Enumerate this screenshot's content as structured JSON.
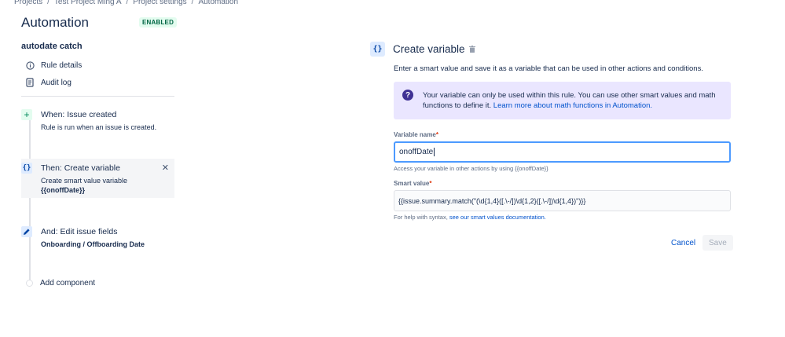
{
  "breadcrumb": [
    "Projects",
    "Test Project Ming A",
    "Project settings",
    "Automation"
  ],
  "page": {
    "title": "Automation",
    "status_badge": "ENABLED"
  },
  "rule": {
    "name": "autodate catch",
    "nav": [
      {
        "label": "Rule details",
        "icon": "info-icon"
      },
      {
        "label": "Audit log",
        "icon": "document-icon"
      }
    ]
  },
  "components": {
    "trigger": {
      "label": "When: Issue created",
      "description": "Rule is run when an issue is created.",
      "icon": "plus-icon"
    },
    "action1": {
      "label": "Then: Create variable",
      "description_line1": "Create smart value variable",
      "description_line2": "{{onoffDate}}",
      "icon": "braces-icon"
    },
    "action2": {
      "label": "And: Edit issue fields",
      "description": "Onboarding / Offboarding Date",
      "icon": "pencil-icon"
    },
    "add_label": "Add component"
  },
  "panel": {
    "icon_text": "{}",
    "title": "Create variable",
    "subtitle": "Enter a smart value and save it as a variable that can be used in other actions and conditions.",
    "info": {
      "text": "Your variable can only be used within this rule. You can use other smart values and math functions to define it.",
      "link": "Learn more about math functions in Automation."
    },
    "variable_name": {
      "label": "Variable name",
      "required_mark": "*",
      "value": "onoffDate",
      "help": "Access your variable in other actions by using {{onoffDate}}"
    },
    "smart_value": {
      "label": "Smart value",
      "required_mark": "*",
      "value": "{{issue.summary.match(\"(\\d{1,4}([.\\-/])\\d{1,2}([.\\-/])\\d{1,4})\")}}",
      "help_prefix": "For help with syntax,",
      "help_link": "see our smart values documentation."
    },
    "buttons": {
      "cancel": "Cancel",
      "save": "Save"
    }
  },
  "colors": {
    "accent": "#0052cc",
    "enabled_bg": "#e3fcef",
    "enabled_text": "#006644",
    "info_bg": "#eae6ff",
    "info_icon": "#403294",
    "focus_border": "#4c9aff"
  }
}
